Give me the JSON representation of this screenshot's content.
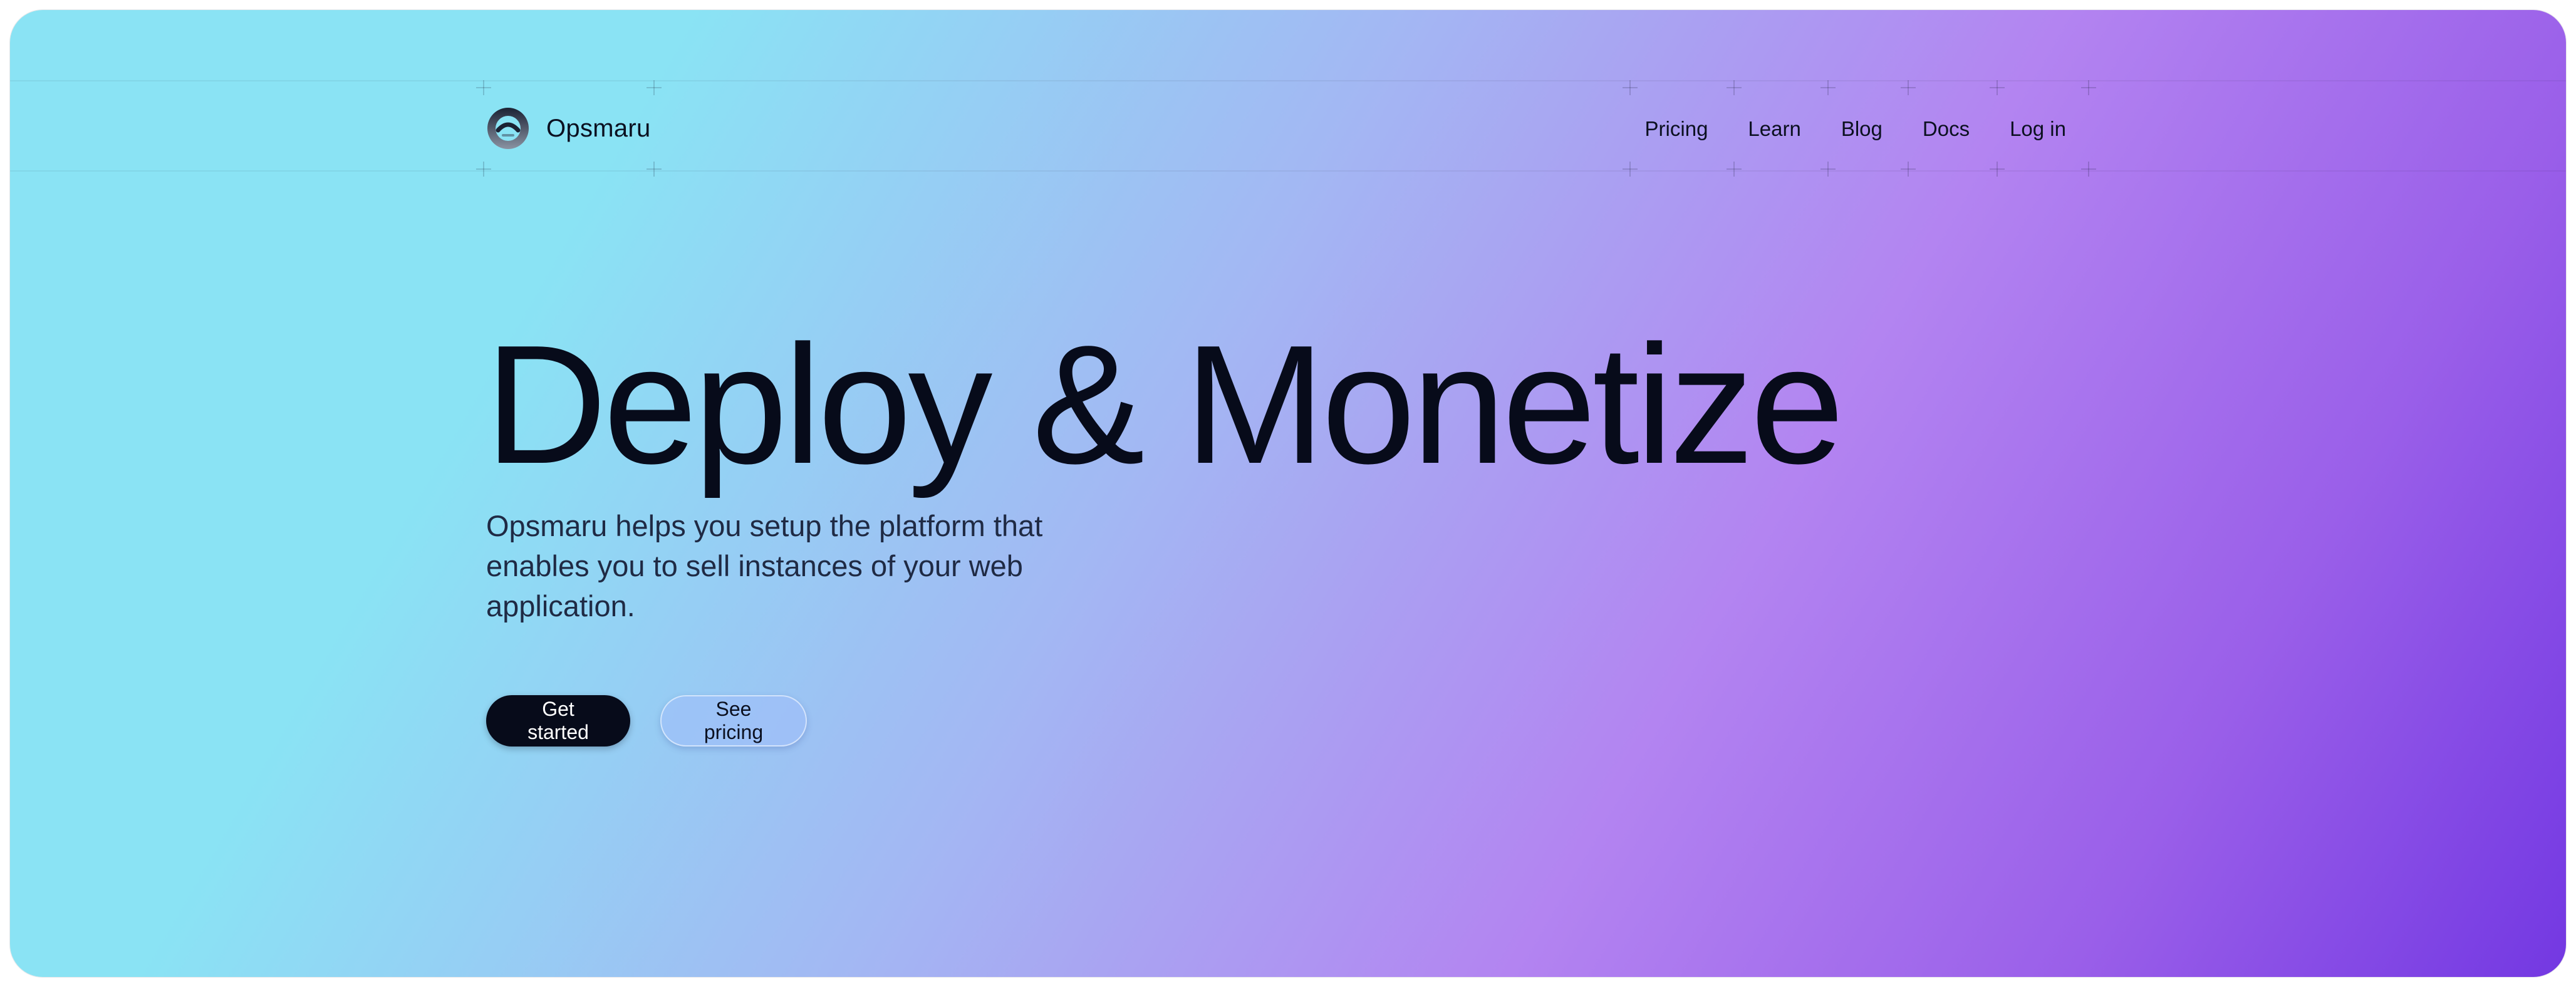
{
  "brand": {
    "name": "Opsmaru",
    "logo_icon": "opsmaru-logo-icon"
  },
  "nav": {
    "items": [
      {
        "label": "Pricing"
      },
      {
        "label": "Learn"
      },
      {
        "label": "Blog"
      },
      {
        "label": "Docs"
      },
      {
        "label": "Log in"
      }
    ]
  },
  "hero": {
    "title": "Deploy & Monetize",
    "subtitle": "Opsmaru helps you setup the platform that enables you to sell instances of your web application.",
    "primary_cta": "Get started",
    "secondary_cta": "See pricing"
  },
  "colors": {
    "gradient_start": "#8ae3f4",
    "gradient_mid": "#b384f1",
    "gradient_end": "#7338e2",
    "text_dark": "#070b1a",
    "primary_button": "#070b1a"
  }
}
